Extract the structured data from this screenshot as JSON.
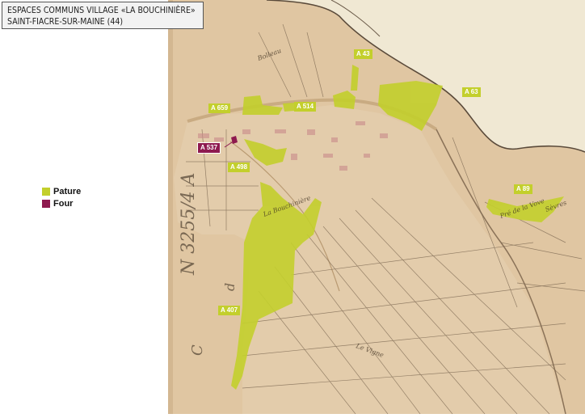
{
  "title": {
    "line1": "ESPACES COMMUNS VILLAGE «LA BOUCHINIÈRE»",
    "line2": "SAINT-FIACRE-SUR-MAINE (44)"
  },
  "legend": [
    {
      "label": "Pature",
      "color": "#c3cf2c"
    },
    {
      "label": "Four",
      "color": "#8e1a4f"
    }
  ],
  "parcels": [
    {
      "label": "A 43",
      "type": "Pature"
    },
    {
      "label": "A 63",
      "type": "Pature"
    },
    {
      "label": "A 659",
      "type": "Pature"
    },
    {
      "label": "A 514",
      "type": "Pature"
    },
    {
      "label": "A 537",
      "type": "Four"
    },
    {
      "label": "A 498",
      "type": "Pature"
    },
    {
      "label": "A 89",
      "type": "Pature"
    },
    {
      "label": "A 407",
      "type": "Pature"
    }
  ],
  "colors": {
    "pature": "#c3cf2c",
    "four": "#8e1a4f",
    "parchment": "#e4ccaa",
    "river": "#f1ead6"
  }
}
